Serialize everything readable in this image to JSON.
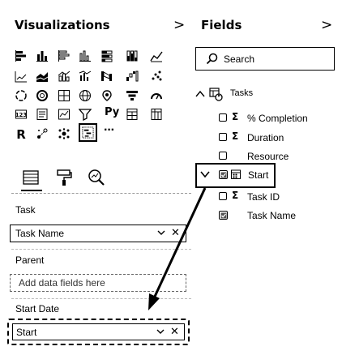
{
  "visualizations": {
    "title": "Visualizations",
    "collapse_glyph": ">",
    "more_glyph": "···",
    "tabs": [
      "build",
      "format",
      "analytics"
    ],
    "wells": [
      {
        "label": "Task",
        "value": "Task Name",
        "placeholder": ""
      },
      {
        "label": "Parent",
        "value": "",
        "placeholder": "Add data fields here"
      },
      {
        "label": "Start Date",
        "value": "Start",
        "placeholder": ""
      }
    ],
    "python_label": "Py"
  },
  "fields": {
    "title": "Fields",
    "collapse_glyph": ">",
    "search_placeholder": "Search",
    "table": {
      "name": "Tasks",
      "expanded": true
    },
    "items": [
      {
        "label": "% Completion",
        "sigma": true,
        "checked": false
      },
      {
        "label": "Duration",
        "sigma": true,
        "checked": false
      },
      {
        "label": "Resource",
        "sigma": false,
        "checked": false
      },
      {
        "label": "Start",
        "sigma": false,
        "checked": true,
        "type": "date-hierarchy"
      },
      {
        "label": "Task ID",
        "sigma": true,
        "checked": false
      },
      {
        "label": "Task Name",
        "sigma": false,
        "checked": true
      }
    ]
  },
  "colors": {
    "highlight": "#000000",
    "dashed_border": "#666666"
  }
}
